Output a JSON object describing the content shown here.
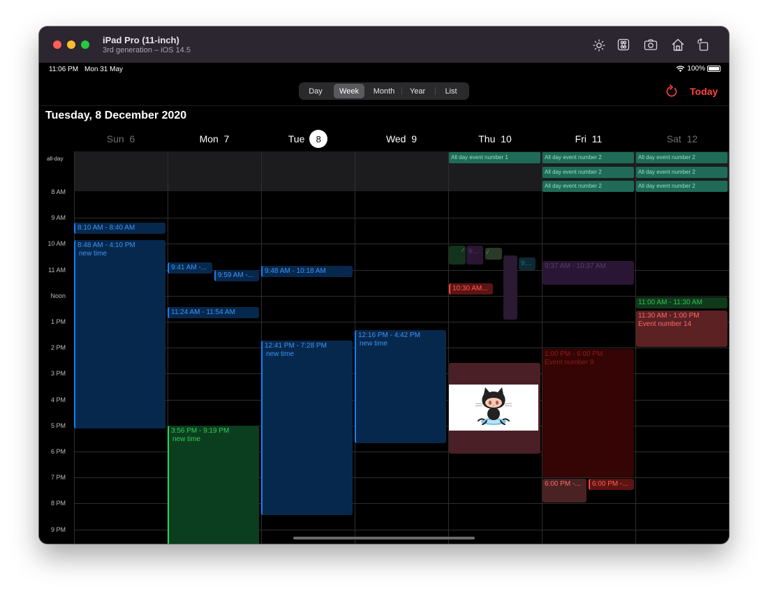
{
  "window": {
    "title": "iPad Pro (11-inch)",
    "subtitle": "3rd generation – iOS 14.5",
    "toolbar_icons": [
      "brightness-icon",
      "command-key-icon",
      "screenshot-icon",
      "home-icon",
      "rotate-icon"
    ]
  },
  "status_bar": {
    "time": "11:06 PM",
    "date": "Mon 31 May",
    "battery": "100%"
  },
  "view_switcher": {
    "options": [
      "Day",
      "Week",
      "Month",
      "Year",
      "List"
    ],
    "selected": "Week"
  },
  "today_button": "Today",
  "date_title": "Tuesday, 8 December 2020",
  "days": [
    {
      "name": "Sun",
      "num": "6"
    },
    {
      "name": "Mon",
      "num": "7"
    },
    {
      "name": "Tue",
      "num": "8"
    },
    {
      "name": "Wed",
      "num": "9"
    },
    {
      "name": "Thu",
      "num": "10"
    },
    {
      "name": "Fri",
      "num": "11"
    },
    {
      "name": "Sat",
      "num": "12"
    }
  ],
  "allday": {
    "label": "all-day",
    "events": {
      "thu_1": "All day event number 1",
      "fri_1": "All day event number 2",
      "fri_2": "All day event number 2",
      "fri_3": "All day event number 2",
      "sat_1": "All day event number 2",
      "sat_2": "All day event number 2",
      "sat_3": "All day event number 2"
    }
  },
  "hours": [
    "8 AM",
    "9 AM",
    "10 AM",
    "11 AM",
    "Noon",
    "1 PM",
    "2 PM",
    "3 PM",
    "4 PM",
    "5 PM",
    "6 PM",
    "7 PM",
    "8 PM",
    "9 PM"
  ],
  "events": {
    "sun_1": {
      "time": "8:10 AM - 8:40 AM"
    },
    "sun_2": {
      "time": "8:48 AM - 4:10 PM",
      "note": "new time"
    },
    "mon_1": {
      "time": "9:41 AM -..."
    },
    "mon_2": {
      "time": "9:59 AM -..."
    },
    "mon_3": {
      "time": "11:24 AM - 11:54 AM"
    },
    "mon_4": {
      "time": "3:56 PM - 9:19 PM",
      "note": "new time"
    },
    "tue_1": {
      "time": "9:48 AM - 10:18 AM"
    },
    "tue_2": {
      "time": "12:41 PM - 7:28 PM",
      "note": "new time"
    },
    "wed_1": {
      "time": "12:16 PM - 4:42 PM",
      "note": "new time"
    },
    "thu_2": {
      "time": "9:..."
    },
    "thu_5": {
      "time": "9:..."
    },
    "thu_6": {
      "time": "10:30 AM..."
    },
    "fri_1": {
      "time": "9:37 AM - 10:37 AM"
    },
    "fri_2": {
      "time": "1:00 PM - 6:00 PM",
      "note": "Event number 9"
    },
    "fri_3": {
      "time": "6:00 PM -..."
    },
    "fri_4": {
      "time": "6:00 PM -..."
    },
    "sat_1": {
      "time": "11:00 AM - 11:30 AM"
    },
    "sat_2": {
      "time": "11:30 AM - 1:00 PM",
      "note": "Event number 14"
    }
  },
  "colors": {
    "accent": "#ff453a",
    "blue_event": "#0a84ff",
    "green_event": "#30d158",
    "allday_event": "#1f6b57"
  }
}
